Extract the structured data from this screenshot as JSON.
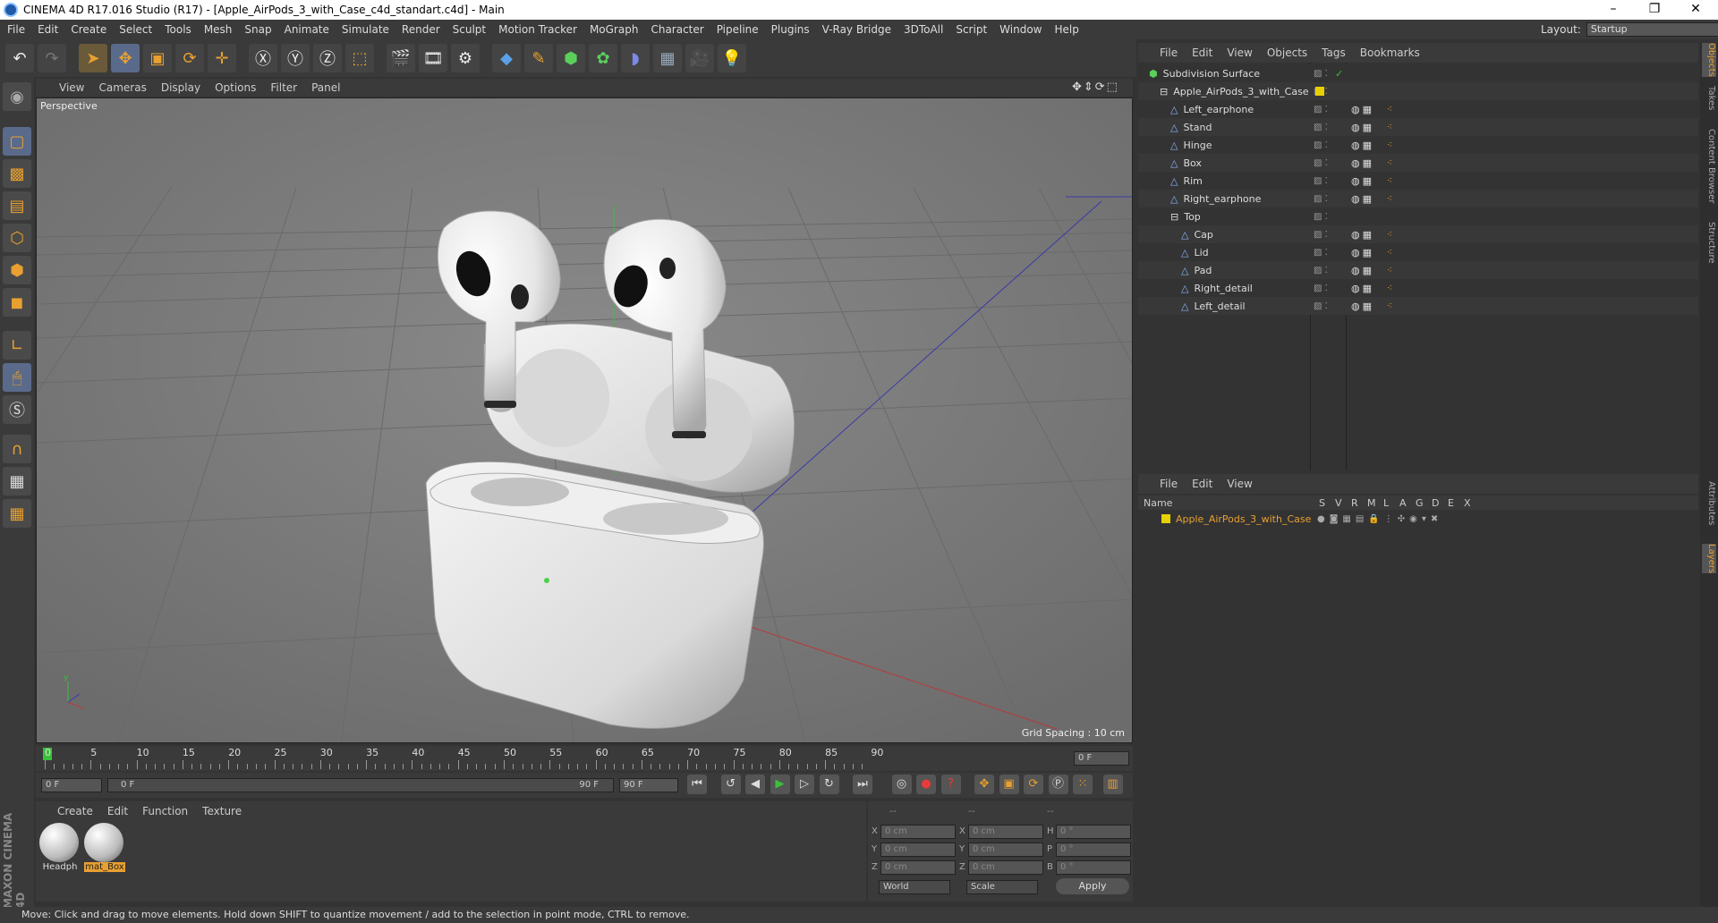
{
  "window": {
    "title": "CINEMA 4D R17.016 Studio (R17) - [Apple_AirPods_3_with_Case_c4d_standart.c4d] - Main"
  },
  "menubar": [
    "File",
    "Edit",
    "Create",
    "Select",
    "Tools",
    "Mesh",
    "Snap",
    "Animate",
    "Simulate",
    "Render",
    "Sculpt",
    "Motion Tracker",
    "MoGraph",
    "Character",
    "Pipeline",
    "Plugins",
    "V-Ray Bridge",
    "3DToAll",
    "Script",
    "Window",
    "Help"
  ],
  "layout": {
    "label": "Layout:",
    "value": "Startup"
  },
  "viewport": {
    "menu": [
      "View",
      "Cameras",
      "Display",
      "Options",
      "Filter",
      "Panel"
    ],
    "camera_label": "Perspective",
    "grid_spacing": "Grid Spacing : 10 cm"
  },
  "timeline": {
    "ticks": [
      "0",
      "5",
      "10",
      "15",
      "20",
      "25",
      "30",
      "35",
      "40",
      "45",
      "50",
      "55",
      "60",
      "65",
      "70",
      "75",
      "80",
      "85",
      "90"
    ],
    "current_frame": "0 F",
    "start_field": "0 F",
    "range_start": "0 F",
    "range_end": "90 F",
    "end_field": "90 F"
  },
  "materials": {
    "menu": [
      "Create",
      "Edit",
      "Function",
      "Texture"
    ],
    "items": [
      "Headph",
      "mat_Box"
    ]
  },
  "coordinates": {
    "headers": [
      "--",
      "--",
      "--"
    ],
    "rows": [
      {
        "a": "X",
        "av": "0 cm",
        "b": "X",
        "bv": "0 cm",
        "c": "H",
        "cv": "0 °"
      },
      {
        "a": "Y",
        "av": "0 cm",
        "b": "Y",
        "bv": "0 cm",
        "c": "P",
        "cv": "0 °"
      },
      {
        "a": "Z",
        "av": "0 cm",
        "b": "Z",
        "bv": "0 cm",
        "c": "B",
        "cv": "0 °"
      }
    ],
    "world": "World",
    "scale": "Scale",
    "apply": "Apply"
  },
  "objects_panel": {
    "menu": [
      "File",
      "Edit",
      "View",
      "Objects",
      "Tags",
      "Bookmarks"
    ],
    "tree": [
      {
        "name": "Subdivision Surface",
        "depth": 0
      },
      {
        "name": "Apple_AirPods_3_with_Case",
        "depth": 1
      },
      {
        "name": "Left_earphone",
        "depth": 2
      },
      {
        "name": "Stand",
        "depth": 2
      },
      {
        "name": "Hinge",
        "depth": 2
      },
      {
        "name": "Box",
        "depth": 2
      },
      {
        "name": "Rim",
        "depth": 2
      },
      {
        "name": "Right_earphone",
        "depth": 2
      },
      {
        "name": "Top",
        "depth": 2
      },
      {
        "name": "Cap",
        "depth": 3
      },
      {
        "name": "Lid",
        "depth": 3
      },
      {
        "name": "Pad",
        "depth": 3
      },
      {
        "name": "Right_detail",
        "depth": 3
      },
      {
        "name": "Left_detail",
        "depth": 3
      }
    ]
  },
  "layers_panel": {
    "menu": [
      "File",
      "Edit",
      "View"
    ],
    "columns": [
      "Name",
      "S",
      "V",
      "R",
      "M",
      "L",
      "A",
      "G",
      "D",
      "E",
      "X"
    ],
    "layer": "Apple_AirPods_3_with_Case"
  },
  "right_tabs": [
    "Objects",
    "Takes",
    "Content Browser",
    "Structure",
    "Attributes",
    "Layers"
  ],
  "status": "Move: Click and drag to move elements. Hold down SHIFT to quantize movement / add to the selection in point mode, CTRL to remove.",
  "brand": "MAXON CINEMA 4D",
  "colors": {
    "accent": "#e8a030",
    "layer_yellow": "#e8d000",
    "object_blue": "#8ab4ff"
  }
}
